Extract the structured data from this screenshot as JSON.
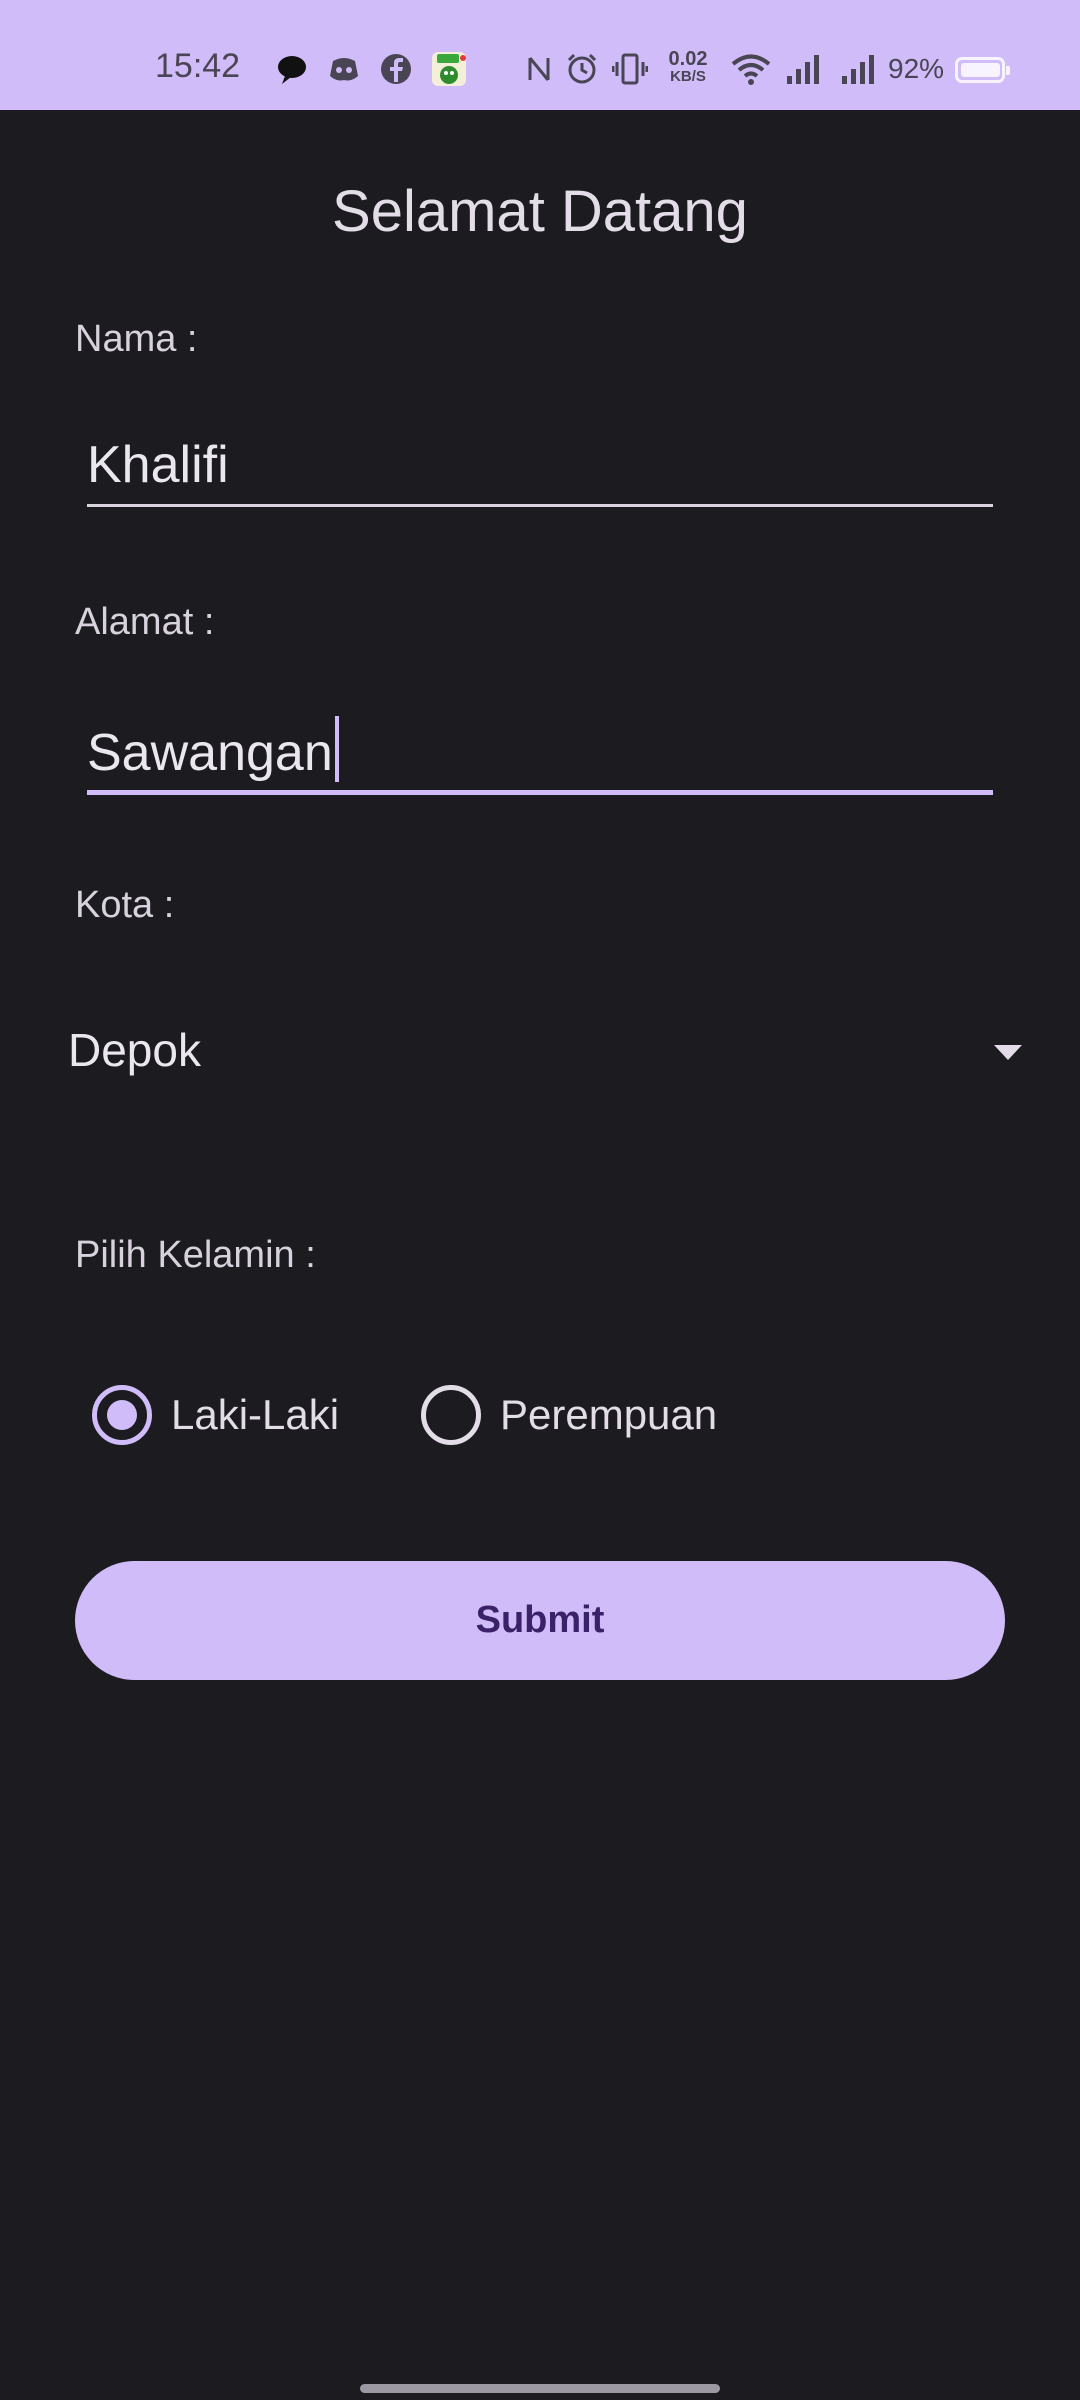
{
  "status_bar": {
    "time": "15:42",
    "notification_icons": [
      "chat-bubble-icon",
      "discord-icon",
      "facebook-icon",
      "game-app-icon"
    ],
    "system_icons": [
      "nfc-icon",
      "alarm-icon",
      "vibrate-icon",
      "wifi-icon",
      "signal-icon",
      "signal-icon"
    ],
    "network_speed_value": "0.02",
    "network_speed_unit": "KB/S",
    "battery_percent": "92%",
    "battery_level": 0.92
  },
  "form": {
    "title": "Selamat Datang",
    "nama": {
      "label": "Nama :",
      "value": "Khalifi"
    },
    "alamat": {
      "label": "Alamat :",
      "value": "Sawangan"
    },
    "kota": {
      "label": "Kota :",
      "selected": "Depok"
    },
    "kelamin": {
      "label": "Pilih Kelamin :",
      "options": [
        {
          "label": "Laki-Laki",
          "checked": true
        },
        {
          "label": "Perempuan",
          "checked": false
        }
      ]
    },
    "submit_label": "Submit"
  },
  "colors": {
    "accent": "#cfbcf8",
    "background": "#1c1b20",
    "on_accent": "#3b2168"
  }
}
